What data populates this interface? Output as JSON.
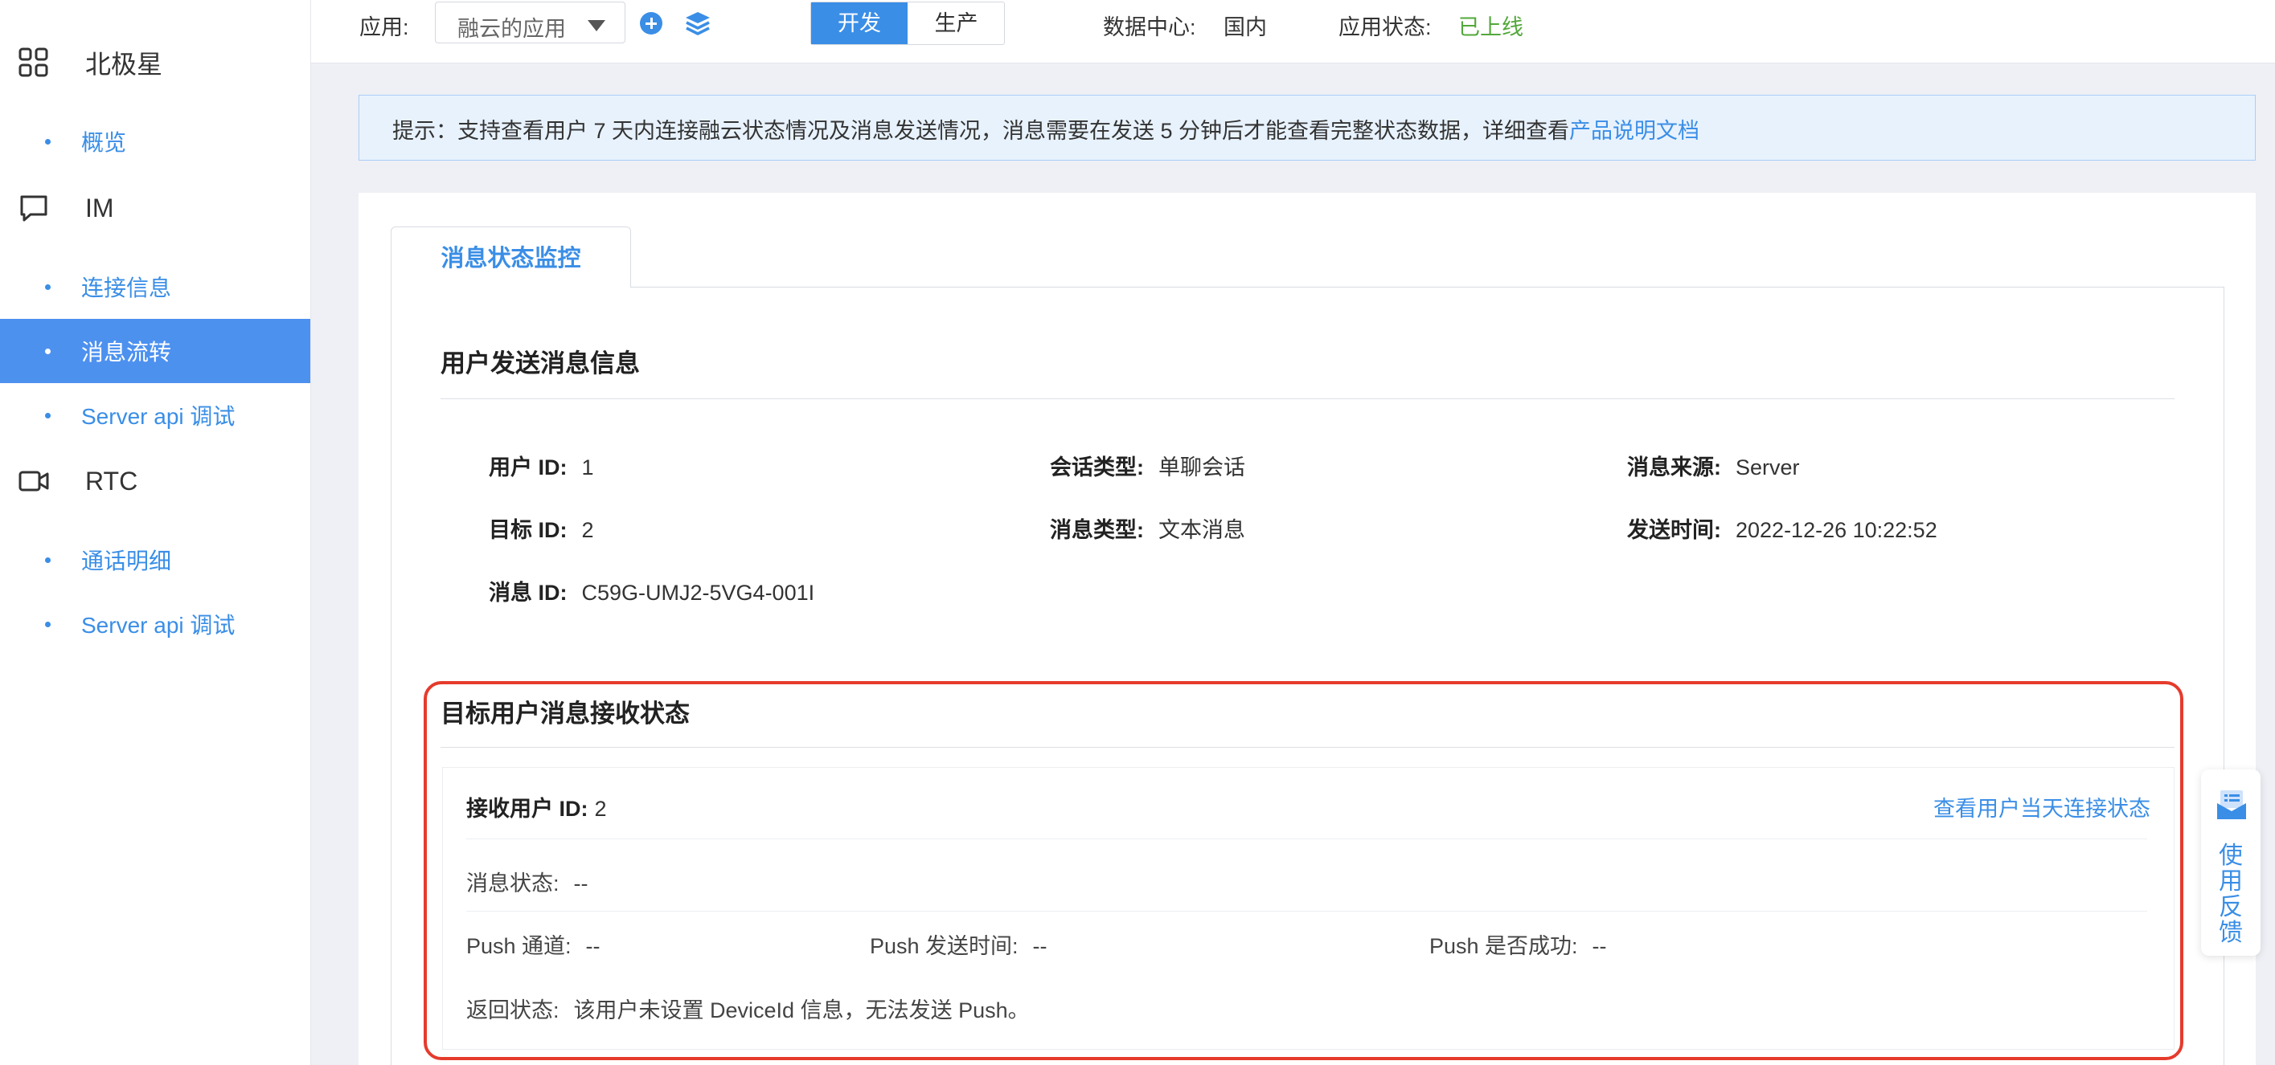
{
  "sidebar": {
    "groups": [
      {
        "label": "北极星",
        "icon": "grid-icon"
      },
      {
        "label": "IM",
        "icon": "chat-bubble-icon"
      },
      {
        "label": "RTC",
        "icon": "video-camera-icon"
      }
    ],
    "items": [
      {
        "label": "概览"
      },
      {
        "label": "连接信息"
      },
      {
        "label": "消息流转"
      },
      {
        "label": "Server api 调试"
      },
      {
        "label": "通话明细"
      },
      {
        "label": "Server api 调试"
      }
    ],
    "active_item": "消息流转"
  },
  "topbar": {
    "app_label": "应用:",
    "app_value": "融云的应用",
    "env_dev": "开发",
    "env_prod": "生产",
    "dc_label": "数据中心:",
    "dc_value": "国内",
    "status_label": "应用状态:",
    "status_value": "已上线"
  },
  "tip": {
    "text": "提示：支持查看用户 7 天内连接融云状态情况及消息发送情况，消息需要在发送 5 分钟后才能查看完整状态数据，详细查看",
    "link": "产品说明文档"
  },
  "tab": {
    "label": "消息状态监控"
  },
  "send_info": {
    "title": "用户发送消息信息",
    "user_id_label": "用户 ID:",
    "user_id": "1",
    "target_id_label": "目标 ID:",
    "target_id": "2",
    "msg_id_label": "消息 ID:",
    "msg_id": "C59G-UMJ2-5VG4-001I",
    "conv_type_label": "会话类型:",
    "conv_type": "单聊会话",
    "msg_type_label": "消息类型:",
    "msg_type": "文本消息",
    "source_label": "消息来源:",
    "source": "Server",
    "send_time_label": "发送时间:",
    "send_time": "2022-12-26 10:22:52"
  },
  "receive_status": {
    "title": "目标用户消息接收状态",
    "recv_user_label": "接收用户 ID:",
    "recv_user": "2",
    "view_link": "查看用户当天连接状态",
    "msg_status_label": "消息状态:",
    "msg_status": "--",
    "push_channel_label": "Push 通道:",
    "push_channel": "--",
    "push_time_label": "Push 发送时间:",
    "push_time": "--",
    "push_success_label": "Push 是否成功:",
    "push_success": "--",
    "return_status_label": "返回状态:",
    "return_status": "该用户未设置 DeviceId 信息，无法发送 Push。"
  },
  "feedback": {
    "label": "使用反馈"
  },
  "colors": {
    "accent": "#3a8ee6",
    "active_bg": "#4d91ef",
    "online": "#52a83a",
    "highlight_border": "#e53b2c"
  }
}
